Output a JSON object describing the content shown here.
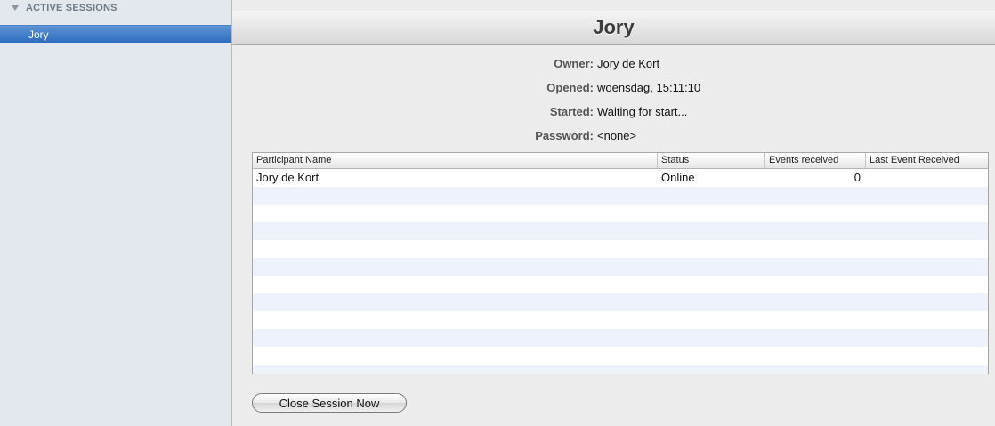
{
  "sidebar": {
    "section_label": "ACTIVE SESSIONS",
    "items": [
      {
        "label": "Jory"
      }
    ]
  },
  "session": {
    "title": "Jory",
    "fields": [
      {
        "label": "Owner:",
        "value": "Jory de Kort"
      },
      {
        "label": "Opened:",
        "value": "woensdag, 15:11:10"
      },
      {
        "label": "Started:",
        "value": "Waiting for start..."
      },
      {
        "label": "Password:",
        "value": "<none>"
      }
    ]
  },
  "participants_table": {
    "columns": [
      "Participant Name",
      "Status",
      "Events received",
      "Last Event Received"
    ],
    "rows": [
      {
        "name": "Jory de Kort",
        "status": "Online",
        "events": "0",
        "last_event": ""
      }
    ]
  },
  "actions": {
    "close_session_label": "Close Session Now"
  },
  "colors": {
    "selection": "#3d7cc9",
    "sidebar_bg": "#e3e8ee",
    "stripe": "#eef2fb"
  }
}
